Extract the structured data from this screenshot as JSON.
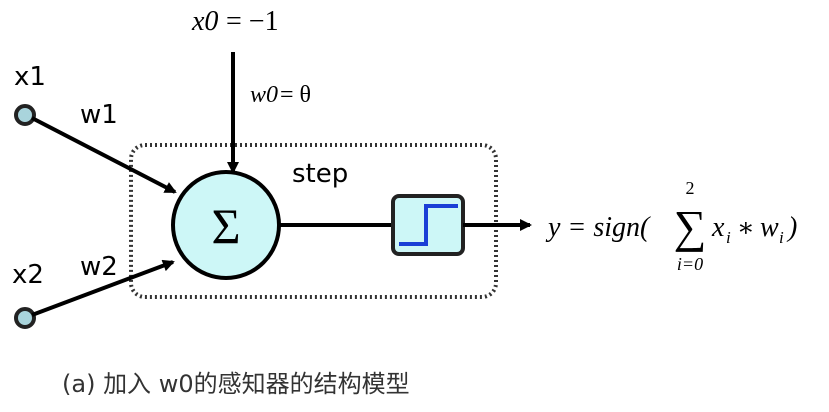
{
  "diagram": {
    "x0_label_var": "x0",
    "x0_label_eq": "= −1",
    "w0_label_var": "w0",
    "w0_label_eq": "= θ",
    "x1_label": "x1",
    "w1_label": "w1",
    "x2_label": "x2",
    "w2_label": "w2",
    "step_label": "step",
    "sum_symbol": "Σ",
    "output_formula": {
      "lhs": "y = sign(",
      "sum_top": "2",
      "sum_symbol": "∑",
      "sum_bottom": "i=0",
      "term_x": "x",
      "term_x_sub": "i",
      "times": "∗",
      "term_w": "w",
      "term_w_sub": "i",
      "close": ")"
    }
  },
  "caption": "(a) 加入 w0的感知器的结构模型",
  "colors": {
    "sum_fill": "#cdf7f7",
    "input_node_fill": "#a9d4dc",
    "step_box_fill": "#cdf7f7",
    "step_line": "#1a3fd6",
    "stroke": "#000000",
    "box_dotted": "#333333",
    "caption_text": "#333333"
  }
}
